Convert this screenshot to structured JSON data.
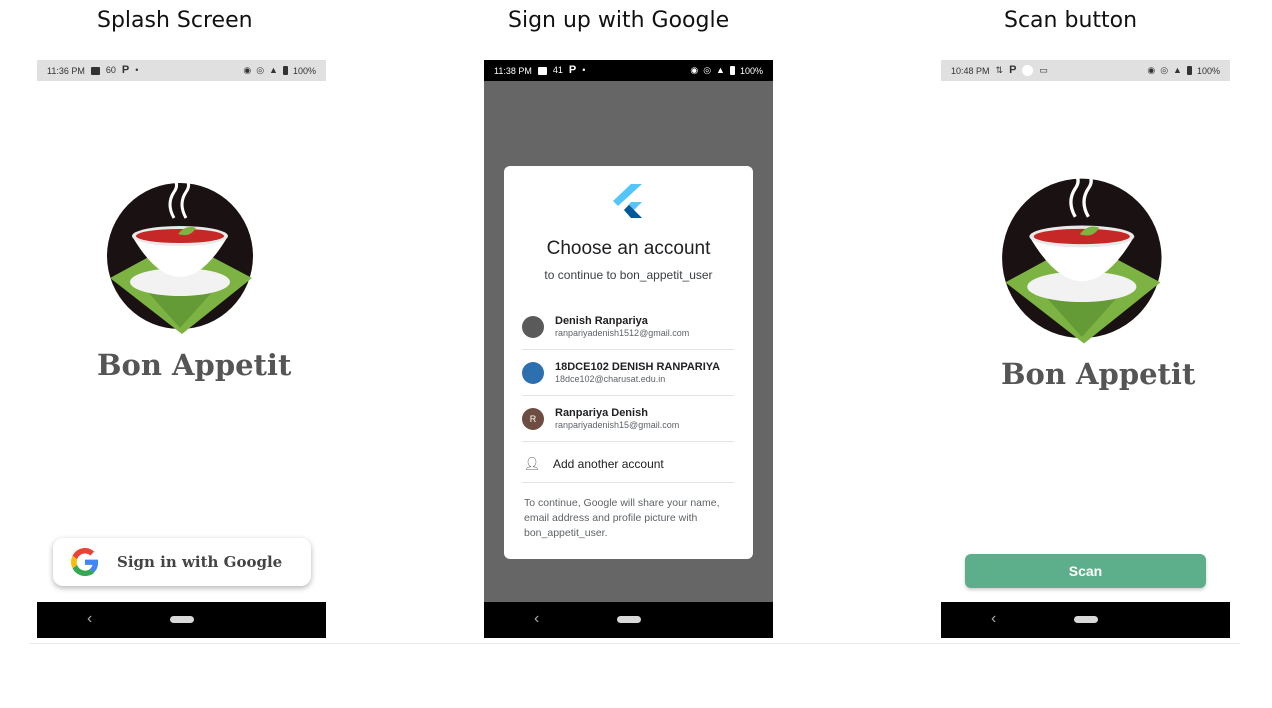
{
  "captions": {
    "splash": "Splash Screen",
    "signup": "Sign up with Google",
    "scan": "Scan button"
  },
  "splash_phone": {
    "status": {
      "time": "11:36 PM",
      "speed": "60",
      "battery": "100%"
    },
    "brand": "Bon Appetit",
    "google_button_label": "Sign in with Google"
  },
  "signup_phone": {
    "status": {
      "time": "11:38 PM",
      "speed": "41",
      "battery": "100%"
    },
    "dialog": {
      "title": "Choose an account",
      "subtitle": "to continue to bon_appetit_user",
      "accounts": [
        {
          "name": "Denish Ranpariya",
          "email": "ranpariyadenish1512@gmail.com",
          "avatar_color": "#5a5a5a"
        },
        {
          "name": "18DCE102 DENISH RANPARIYA",
          "email": "18dce102@charusat.edu.in",
          "avatar_color": "#2e6fb0"
        },
        {
          "name": "Ranpariya Denish",
          "email": "ranpariyadenish15@gmail.com",
          "avatar_letter": "R",
          "avatar_color": "#6d4c41"
        }
      ],
      "add_account_label": "Add another account",
      "note": "To continue, Google will share your name, email address and profile picture with bon_appetit_user."
    }
  },
  "scan_phone": {
    "status": {
      "time": "10:48 PM",
      "battery": "100%"
    },
    "brand": "Bon Appetit",
    "scan_label": "Scan"
  },
  "icons": {
    "back": "back-icon",
    "home": "home-pill-icon",
    "google": "google-g-icon",
    "flutter": "flutter-logo-icon",
    "add_person": "add-person-icon"
  },
  "colors": {
    "scan_green": "#5daf8b",
    "soup_red": "#d32f2f",
    "napkin_green": "#7cb342",
    "overlay_gray": "#666666"
  }
}
